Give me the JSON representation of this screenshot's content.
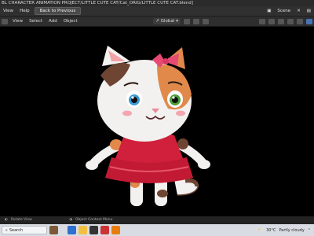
{
  "window": {
    "title": "BL CHARACTER ANIMATION PROJECT/LITTLE CUTE CAT/Cat_ORIG/LITTLE CUTE CAT.blend]"
  },
  "menubar": {
    "items": [
      "View",
      "Help"
    ],
    "back_button": "Back to Previous",
    "scene_label": "Scene"
  },
  "toolbar": {
    "items": [
      "View",
      "Select",
      "Add",
      "Object"
    ],
    "transform_orientation": "Global"
  },
  "statusbar": {
    "left": "Rotate View",
    "middle": "Object Context Menu"
  },
  "taskbar": {
    "search_placeholder": "Search",
    "weather_temp": "30°C",
    "weather_text": "Partly cloudy"
  },
  "colors": {
    "cat_fur": "#f2f1ef",
    "cat_orange": "#e0894a",
    "cat_brown": "#6e4432",
    "dress": "#d1203b",
    "bow": "#e64a73"
  }
}
